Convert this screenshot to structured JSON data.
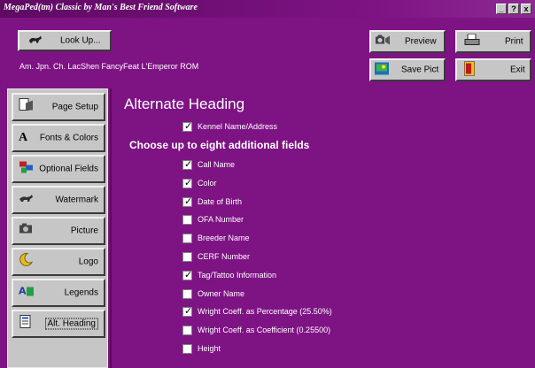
{
  "window": {
    "title": "MegaPed(tm) Classic by Man's Best Friend Software",
    "controls": [
      "_",
      "?",
      "x"
    ]
  },
  "toolbar": {
    "lookup_label": "Look Up...",
    "preview_label": "Preview",
    "print_label": "Print",
    "save_pict_label": "Save Pict",
    "exit_label": "Exit",
    "dog_path": "Am. Jpn. Ch. LacShen FancyFeat L'Emperor ROM"
  },
  "sidebar": {
    "items": [
      {
        "label": "Page Setup",
        "icon": "page-setup-icon"
      },
      {
        "label": "Fonts & Colors",
        "icon": "font-icon"
      },
      {
        "label": "Optional Fields",
        "icon": "fields-icon"
      },
      {
        "label": "Watermark",
        "icon": "watermark-icon"
      },
      {
        "label": "Picture",
        "icon": "picture-icon"
      },
      {
        "label": "Logo",
        "icon": "logo-icon"
      },
      {
        "label": "Legends",
        "icon": "legends-icon"
      },
      {
        "label": "Alt. Heading",
        "icon": "alt-heading-icon"
      }
    ]
  },
  "main": {
    "heading": "Alternate Heading",
    "kennel": {
      "label": "Kennel Name/Address",
      "checked": true
    },
    "subheading": "Choose up to eight additional fields",
    "fields": [
      {
        "label": "Call Name",
        "checked": true
      },
      {
        "label": "Color",
        "checked": true
      },
      {
        "label": "Date of Birth",
        "checked": true
      },
      {
        "label": "OFA Number",
        "checked": false
      },
      {
        "label": "Breeder Name",
        "checked": false
      },
      {
        "label": "CERF Number",
        "checked": false
      },
      {
        "label": "Tag/Tattoo Information",
        "checked": true
      },
      {
        "label": "Owner Name",
        "checked": false
      },
      {
        "label": "Wright Coeff. as Percentage (25.50%)",
        "checked": true
      },
      {
        "label": "Wright Coeff. as Coefficient (0.25500)",
        "checked": false
      },
      {
        "label": "Height",
        "checked": false
      }
    ]
  },
  "colors": {
    "background": "#7e1384",
    "button_face": "#c6c6c6",
    "text": "#ffffff"
  }
}
